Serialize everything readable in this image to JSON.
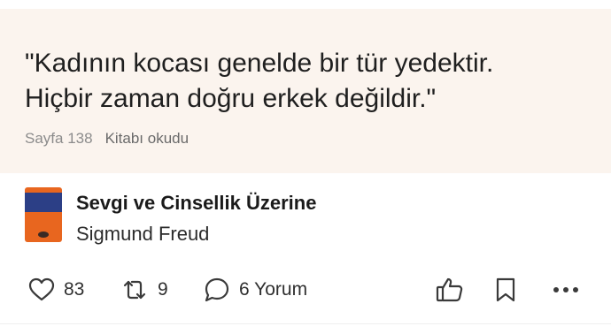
{
  "quote": {
    "text": "\"Kadının kocası genelde bir tür yedektir.\nHiçbir zaman doğru erkek değildir.\"",
    "page": "Sayfa 138",
    "status": "Kitabı okudu"
  },
  "book": {
    "title": "Sevgi ve Cinsellik Üzerine",
    "author": "Sigmund Freud",
    "cover_icon": "book-cover-image"
  },
  "actions": {
    "likes": "83",
    "reposts": "9",
    "comments": "6 Yorum"
  },
  "colors": {
    "card_bg": "#fbf4ee",
    "cover_orange": "#e8661f",
    "cover_blue": "#2c3f86"
  }
}
